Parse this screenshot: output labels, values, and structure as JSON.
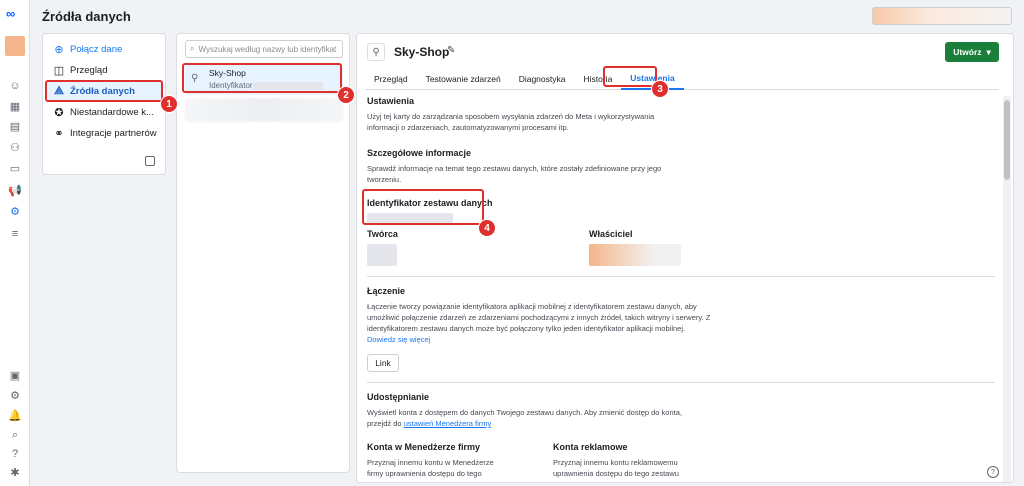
{
  "app": {
    "title": "Źródła danych"
  },
  "nav": {
    "items": [
      {
        "label": "Połącz dane",
        "icon": "plus-circle-icon"
      },
      {
        "label": "Przegląd",
        "icon": "overview-icon"
      },
      {
        "label": "Źródła danych",
        "icon": "data-sources-icon"
      },
      {
        "label": "Niestandardowe k...",
        "icon": "custom-conversions-icon"
      },
      {
        "label": "Integracje partnerów",
        "icon": "partner-integrations-icon"
      }
    ]
  },
  "list": {
    "search_placeholder": "Wyszukaj według nazwy lub identyfikat",
    "selected": {
      "name": "Sky-Shop",
      "id_label": "Identyfikator"
    }
  },
  "main": {
    "title": "Sky-Shop",
    "create_label": "Utwórz",
    "tabs": [
      "Przegląd",
      "Testowanie zdarzeń",
      "Diagnostyka",
      "Historia",
      "Ustawienia"
    ],
    "active_tab": "Ustawienia",
    "settings": {
      "title": "Ustawienia",
      "desc1": "Użyj tej karty do zarządzania sposobem wysyłania zdarzeń do Meta i wykorzystywania",
      "desc2": "informacji o zdarzeniach, zautomatyzowanymi procesami itp."
    },
    "details": {
      "title": "Szczegółowe informacje",
      "desc1": "Sprawdź informacje na temat tego zestawu danych, które zostały zdefiniowane przy jego",
      "desc2": "tworzeniu.",
      "dataset_id_label": "Identyfikator zestawu danych",
      "creator_label": "Twórca",
      "owner_label": "Właściciel"
    },
    "linking": {
      "title": "Łączenie",
      "desc1": "Łączenie tworzy powiązanie identyfikatora aplikacji mobilnej z identyfikatorem zestawu danych, aby",
      "desc2": "umożliwić połączenie zdarzeń ze zdarzeniami pochodzącymi z innych źródeł, takich witryny i serwery. Z",
      "desc3": "identyfikatorem zestawu danych może być połączony tylko jeden identyfikator aplikacji mobilnej.",
      "learn_more": "Dowiedz się więcej",
      "button": "Link"
    },
    "sharing": {
      "title": "Udostępnianie",
      "desc1": "Wyświetl konta z dostępem do danych Twojego zestawu danych. Aby zmienić dostęp do konta,",
      "desc2_prefix": "przejdź do",
      "desc2_link": "ustawień Menedżera firmy",
      "bm_title": "Konta w Menedżerze firmy",
      "bm_desc1": "Przyznaj innemu kontu w Menedżerze",
      "bm_desc2": "firmy uprawnienia dostępu do tego",
      "ad_title": "Konta reklamowe",
      "ad_desc1": "Przyznaj innemu kontu reklamowemu",
      "ad_desc2": "uprawnienia dostępu do tego zestawu"
    }
  },
  "annotations": [
    "1",
    "2",
    "3",
    "4"
  ],
  "colors": {
    "accent": "#1877f2",
    "create": "#1b7f3b",
    "highlight": "#e0302e"
  }
}
